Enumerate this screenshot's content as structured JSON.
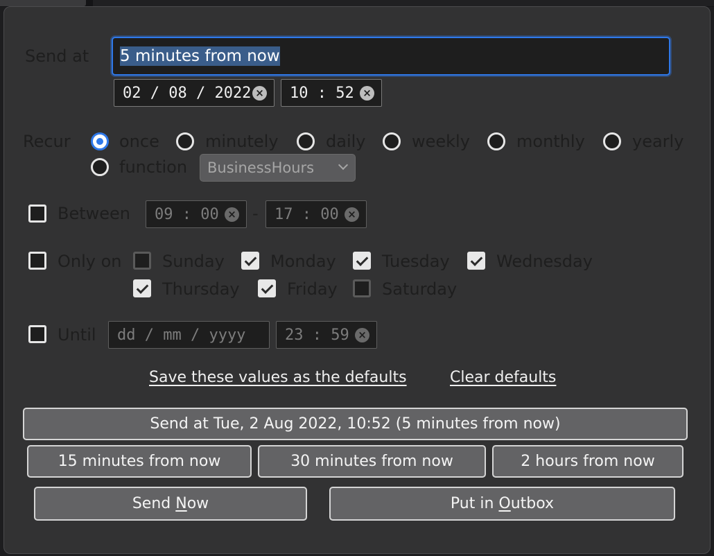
{
  "send_at": {
    "label": "Send at",
    "text_value": "5 minutes from now",
    "date_value": "02 / 08 / 2022",
    "time_value": "10 : 52"
  },
  "recur": {
    "label": "Recur",
    "options": [
      "once",
      "minutely",
      "daily",
      "weekly",
      "monthly",
      "yearly",
      "function"
    ],
    "selected": "once",
    "function_select": "BusinessHours"
  },
  "between": {
    "label": "Between",
    "start": "09 : 00",
    "separator": "-",
    "end": "17 : 00",
    "checked": false
  },
  "only_on": {
    "label": "Only on",
    "checked": false,
    "days": [
      {
        "name": "Sunday",
        "checked": false
      },
      {
        "name": "Monday",
        "checked": true
      },
      {
        "name": "Tuesday",
        "checked": true
      },
      {
        "name": "Wednesday",
        "checked": true
      },
      {
        "name": "Thursday",
        "checked": true
      },
      {
        "name": "Friday",
        "checked": true
      },
      {
        "name": "Saturday",
        "checked": false
      }
    ]
  },
  "until": {
    "label": "Until",
    "checked": false,
    "date_placeholder": "dd / mm / yyyy",
    "time_value": "23 : 59"
  },
  "links": {
    "save_defaults": "Save these values as the defaults",
    "clear_defaults": "Clear defaults"
  },
  "buttons": {
    "send_at": "Send at Tue, 2 Aug 2022, 10:52 (5 minutes from now)",
    "fifteen": "15 minutes from now",
    "thirty": "30 minutes from now",
    "two_hours": "2 hours from now",
    "send_now_pre": "Send ",
    "send_now_key": "N",
    "send_now_post": "ow",
    "outbox_pre": "Put in ",
    "outbox_key": "O",
    "outbox_post": "utbox"
  },
  "colors": {
    "accent": "#2f79ea",
    "dialog_bg": "#323233",
    "dimmed_text": "#1e1e1e"
  }
}
